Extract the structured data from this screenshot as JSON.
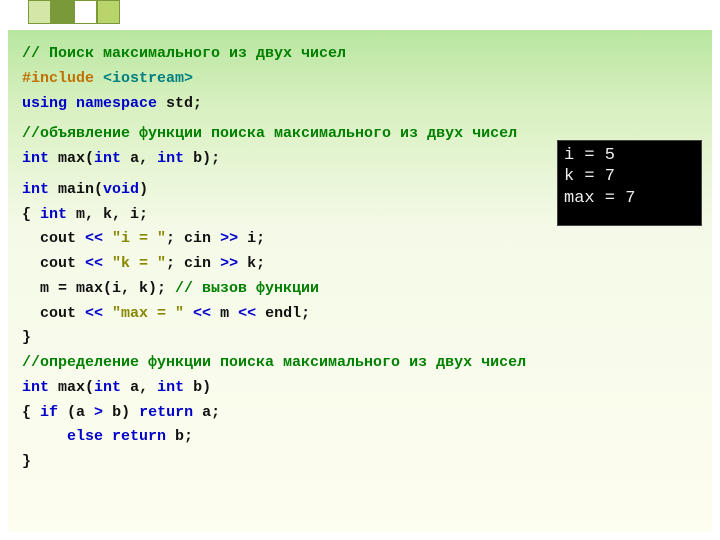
{
  "code": {
    "l1": "// Поиск максимального из двух чисел",
    "l2a": "#include ",
    "l2b": "<iostream>",
    "l3a": "using ",
    "l3b": "namespace ",
    "l3c": "std",
    "l3d": ";",
    "l4": "//объявление функции поиска максимального из двух чисел",
    "l5a": "int ",
    "l5b": "max",
    "l5c": "(",
    "l5d": "int ",
    "l5e": "a",
    "l5f": ", ",
    "l5g": "int ",
    "l5h": "b",
    "l5i": ");",
    "l6a": "int ",
    "l6b": "main",
    "l6c": "(",
    "l6d": "void",
    "l6e": ")",
    "l7a": "{ ",
    "l7b": "int ",
    "l7c": "m, k, i;",
    "l8a": "  cout ",
    "l8b": "<< ",
    "l8c": "\"i = \"",
    "l8d": "; cin ",
    "l8e": ">> ",
    "l8f": "i;",
    "l9a": "  cout ",
    "l9b": "<< ",
    "l9c": "\"k = \"",
    "l9d": "; cin ",
    "l9e": ">> ",
    "l9f": "k;",
    "l10a": "  m = max(i, k); ",
    "l10b": "// вызов функции",
    "l11a": "  cout ",
    "l11b": "<< ",
    "l11c": "\"max = \" ",
    "l11d": "<< ",
    "l11e": "m ",
    "l11f": "<< ",
    "l11g": "endl; ",
    "l12": "}",
    "l13": "//определение функции поиска максимального из двух чисел",
    "l14a": "int ",
    "l14b": "max",
    "l14c": "(",
    "l14d": "int ",
    "l14e": "a",
    "l14f": ", ",
    "l14g": "int ",
    "l14h": "b",
    "l14i": ")",
    "l15a": "{ ",
    "l15b": "if ",
    "l15c": "(a ",
    "l15d": "> ",
    "l15e": "b) ",
    "l15f": "return ",
    "l15g": "a;",
    "l16a": "     ",
    "l16b": "else ",
    "l16c": "return ",
    "l16d": "b;",
    "l17": "}"
  },
  "console": {
    "r1": "i = 5",
    "r2": "k = 7",
    "r3": "max = 7"
  }
}
